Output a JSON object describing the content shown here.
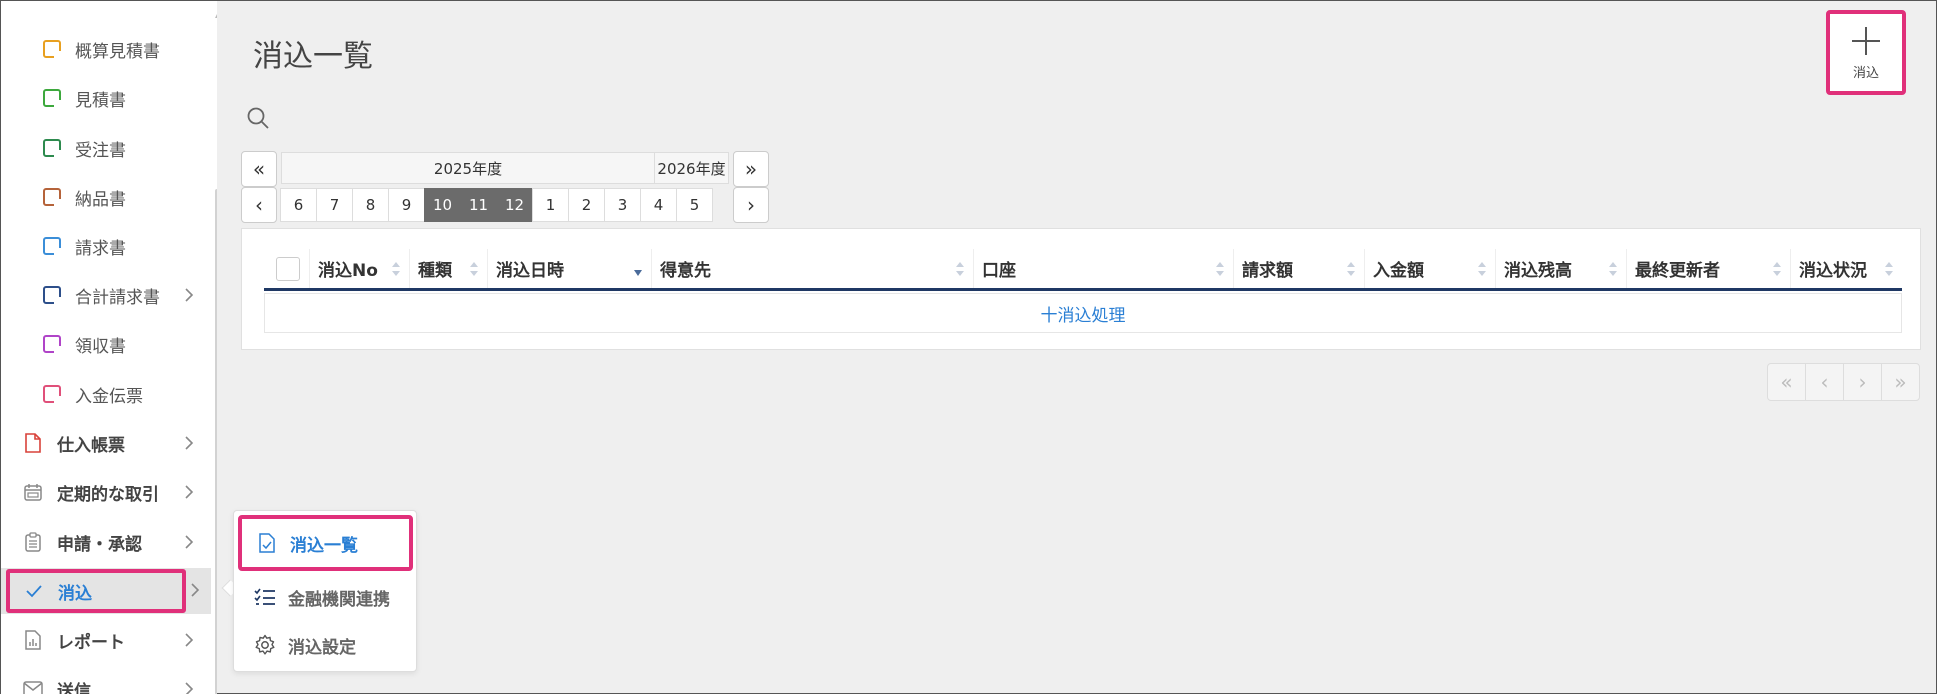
{
  "sidebar": {
    "sub_items": [
      {
        "label": "概算見積書",
        "color": "#e8a020"
      },
      {
        "label": "見積書",
        "color": "#3da83d"
      },
      {
        "label": "受注書",
        "color": "#2d8a4e"
      },
      {
        "label": "納品書",
        "color": "#b5633a"
      },
      {
        "label": "請求書",
        "color": "#3b8ed8"
      },
      {
        "label": "合計請求書",
        "color": "#2d4f8a"
      },
      {
        "label": "領収書",
        "color": "#b044c8"
      },
      {
        "label": "入金伝票",
        "color": "#e0507a"
      }
    ],
    "top_items": [
      {
        "label": "仕入帳票",
        "icon": "document-icon",
        "color": "#d9423a"
      },
      {
        "label": "定期的な取引",
        "icon": "calendar-icon"
      },
      {
        "label": "申請・承認",
        "icon": "clipboard-icon"
      },
      {
        "label": "消込",
        "icon": "check-icon",
        "active": true
      },
      {
        "label": "レポート",
        "icon": "report-icon"
      },
      {
        "label": "送信",
        "icon": "mail-icon"
      }
    ]
  },
  "header": {
    "title": "消込一覧",
    "add_label": "消込"
  },
  "picker": {
    "prev_year": "«",
    "next_year": "»",
    "prev_month": "‹",
    "next_month": "›",
    "current_year": "2025年度",
    "next_year_label": "2026年度",
    "months": [
      "6",
      "7",
      "8",
      "9",
      "10",
      "11",
      "12",
      "1",
      "2",
      "3",
      "4",
      "5"
    ],
    "selected_months": [
      "10",
      "11",
      "12"
    ]
  },
  "table": {
    "columns": [
      "消込No",
      "種類",
      "消込日時",
      "得意先",
      "口座",
      "請求額",
      "入金額",
      "消込残高",
      "最終更新者",
      "消込状況"
    ],
    "action_row": "十消込処理"
  },
  "pager": [
    "«",
    "‹",
    "›",
    "»"
  ],
  "popup": {
    "items": [
      {
        "label": "消込一覧",
        "active": true
      },
      {
        "label": "金融機関連携"
      },
      {
        "label": "消込設定"
      }
    ]
  },
  "colors": {
    "accent": "#2a7fd4",
    "highlight": "#e0307a",
    "header_rule": "#1f3864",
    "selected_month": "#6b6b6b"
  }
}
